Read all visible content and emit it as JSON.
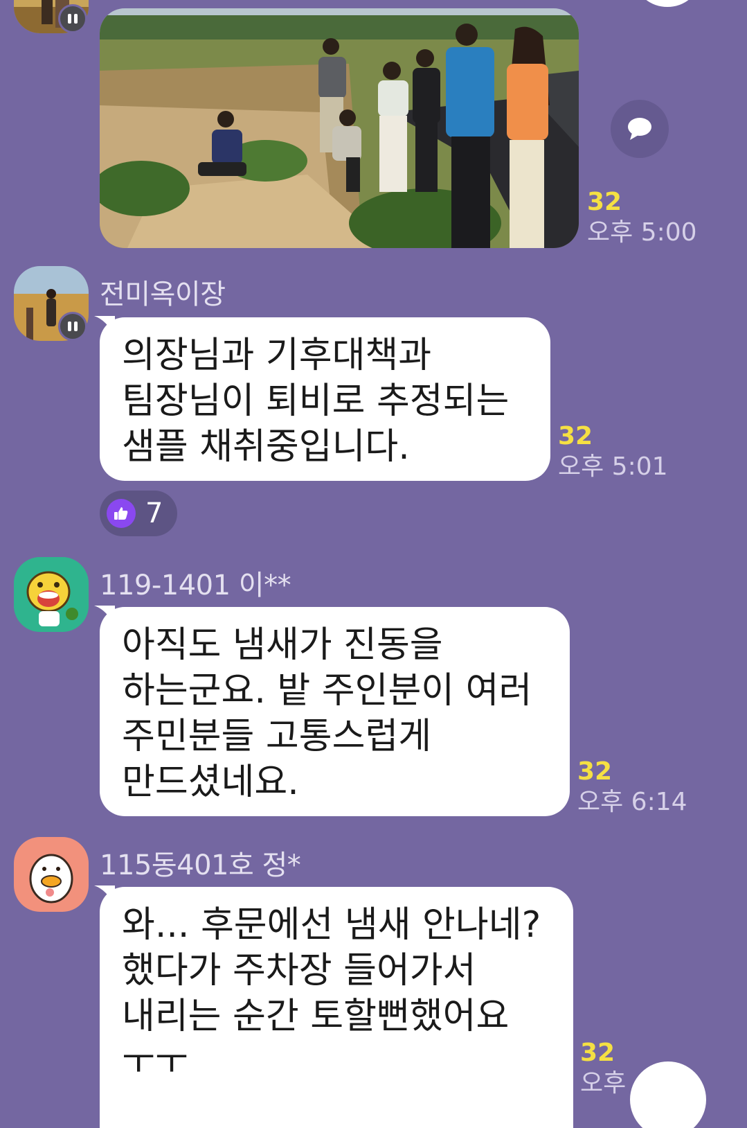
{
  "messages": [
    {
      "sender": "",
      "type": "image",
      "unread": "32",
      "time": "오후 5:00"
    },
    {
      "sender": "전미옥이장",
      "type": "text",
      "text": "의장님과 기후대책과\n팀장님이 퇴비로 추정되는\n샘플 채취중입니다.",
      "unread": "32",
      "time": "오후 5:01",
      "reaction": {
        "icon": "thumbs-up-icon",
        "count": "7"
      }
    },
    {
      "sender": "119-1401 이**",
      "type": "text",
      "text": "아직도 냄새가 진동을\n하는군요. 밭 주인분이 여러\n주민분들 고통스럽게\n만드셨네요.",
      "unread": "32",
      "time": "오후 6:14"
    },
    {
      "sender": "115동401호 정*",
      "type": "text",
      "text": "와... 후문에선 냄새 안나네?\n했다가 주차장 들어가서\n내리는 순간 토할뻔했어요\nㅜㅜ",
      "unread": "32",
      "time": "오후"
    }
  ],
  "colors": {
    "background": "#7467a1",
    "bubble": "#ffffff",
    "unread": "#f5e043",
    "reaction_icon": "#8a48f0"
  },
  "icons": {
    "share": "share-bubble-icon",
    "avatar_badge": "pause-badge-icon"
  }
}
